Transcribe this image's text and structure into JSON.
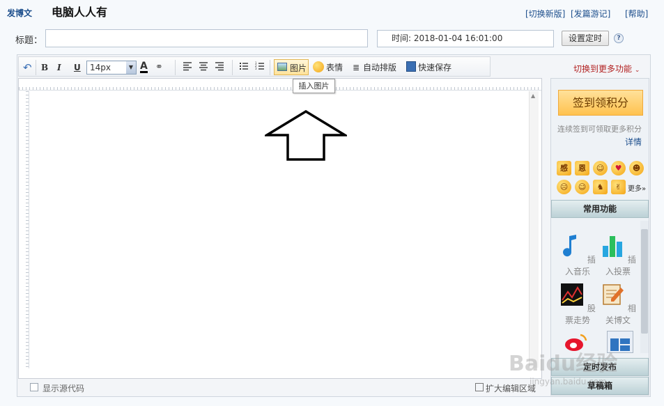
{
  "header": {
    "tab_label": "发博文",
    "blog_name": "电脑人人有",
    "switch_version": "[切换新版]",
    "travel_note": "[发篇游记]",
    "help": "[帮助]"
  },
  "title_row": {
    "label": "标题：",
    "title_value": "",
    "time_label": "时间:",
    "time_value": "2018-01-04 16:01:00",
    "schedule_button": "设置定时",
    "help_icon": "?"
  },
  "toolbar": {
    "undo_icon": "undo-icon",
    "bold": "B",
    "italic": "I",
    "underline": "U",
    "font_size": "14px",
    "font_color_glyph": "A",
    "image_label": "图片",
    "emoji_label": "表情",
    "autoformat_label": "自动排版",
    "quicksave_label": "快速保存",
    "more_features": "切换到更多功能",
    "tooltip": "插入图片"
  },
  "editor": {
    "content": ""
  },
  "footer": {
    "show_source": "显示源代码",
    "expand_label": "扩大编辑区域"
  },
  "sidebar": {
    "signin_button": "签到领积分",
    "signin_desc": "连续签到可领取更多积分",
    "details_link": "详情",
    "emotions_more": "更多»",
    "common_section": "常用功能",
    "tools": [
      {
        "label": "插入音乐"
      },
      {
        "label": "插入投票"
      },
      {
        "label": "股票走势"
      },
      {
        "label": "相关博文"
      }
    ],
    "timed_section": "定时发布",
    "draft_section": "草稿箱"
  },
  "watermark": {
    "text": "Baidu经验",
    "url": "jingyan.baidu.com"
  },
  "colors": {
    "accent_blue": "#1c4e8c",
    "signin_orange": "#ffd27a",
    "more_red": "#b22222"
  }
}
